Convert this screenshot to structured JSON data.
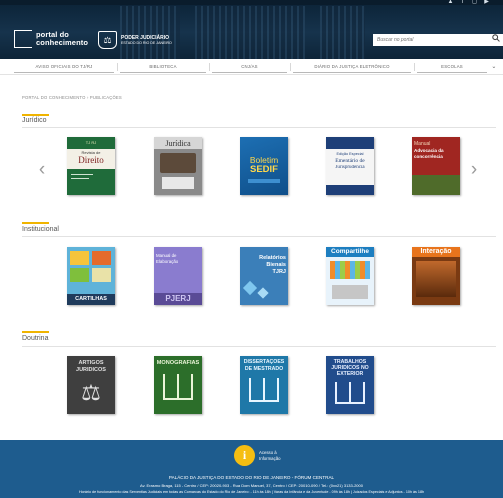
{
  "header": {
    "portal_line1": "portal do",
    "portal_line2": "conhecimento",
    "pj_title": "PODER JUDICIÁRIO",
    "pj_subtitle": "ESTADO DO RIO DE JANEIRO",
    "search_placeholder": "Buscar no portal",
    "social_icons": [
      "twitter-icon",
      "facebook-icon",
      "instagram-icon",
      "youtube-icon"
    ]
  },
  "nav": {
    "items": [
      {
        "label": "AVISO OFICIAIS DO TJ/RJ"
      },
      {
        "label": "BIBLIOTECA"
      },
      {
        "label": "CNJ/AS"
      },
      {
        "label": "DIÁRIO DA JUSTIÇA ELETRÔNICO"
      },
      {
        "label": "ESCOLAS"
      }
    ],
    "more_icon": "chevron-down-icon"
  },
  "breadcrumb": "PORTAL DO CONHECIMENTO  ›  PUBLICAÇÕES",
  "sections": [
    {
      "title": "Jurídico",
      "books": [
        {
          "l1": "TJ RJ",
          "l2": "Revista de",
          "l3": "Direito",
          "color": "#1f6b3a"
        },
        {
          "l1": "",
          "l2": "Jurídica",
          "l3": "",
          "color": "#8a8a8a"
        },
        {
          "l1": "",
          "l2": "Boletim",
          "l3": "SEDIF",
          "color": "#1d6fb3"
        },
        {
          "l1": "Edição Especial",
          "l2": "Ementário de",
          "l3": "Jurisprudência",
          "color": "#1e3f78"
        },
        {
          "l1": "Manual",
          "l2": "Advocacia da",
          "l3": "concorrência",
          "color": "#a02621"
        }
      ]
    },
    {
      "title": "Institucional",
      "books": [
        {
          "l1": "",
          "l2": "",
          "l3": "CARTILHAS",
          "color": "#2e6fa8"
        },
        {
          "l1": "Manual de",
          "l2": "Elaboração",
          "l3": "PJERJ",
          "color": "#6a5aa5"
        },
        {
          "l1": "Relatórios",
          "l2": "Bienais",
          "l3": "TJRJ",
          "color": "#3b7fb9"
        },
        {
          "l1": "Compartilhe",
          "l2": "",
          "l3": "",
          "color": "#1d7ec0"
        },
        {
          "l1": "Interação",
          "l2": "",
          "l3": "",
          "color": "#7a3a12"
        }
      ]
    },
    {
      "title": "Doutrina",
      "books": [
        {
          "l1": "ARTIGOS",
          "l2": "JURÍDICOS",
          "l3": "",
          "color": "#3f3f3f"
        },
        {
          "l1": "MONOGRAFIAS",
          "l2": "",
          "l3": "",
          "color": "#2c6e2a"
        },
        {
          "l1": "DISSERTAÇÕES",
          "l2": "DE MESTRADO",
          "l3": "",
          "color": "#1f78a8"
        },
        {
          "l1": "TRABALHOS",
          "l2": "JURÍDICOS NO",
          "l3": "EXTERIOR",
          "color": "#214c8c"
        }
      ]
    }
  ],
  "carousel": {
    "prev_icon": "chevron-left-icon",
    "next_icon": "chevron-right-icon"
  },
  "footer": {
    "acesso_line1": "Acesso à",
    "acesso_line2": "Informação",
    "line1": "PALÁCIO DA JUSTIÇA DO ESTADO DO RIO DE JANEIRO - FÓRUM CENTRAL",
    "line2": "Av. Erasmo Braga, 115 - Centro / CEP: 20020-903 - Rua Dom Manuel, 37, Centro / CEP: 20010-090 / Tel.: (0xx21) 3133-2000",
    "line3": "Horário de funcionamento das Serventias Judiciais em todas as Comarcas do Estado do Rio de Janeiro: - 11h às 18h | Varas da Infância e da Juventude - 09h às 18h | Juizados Especiais e Adjuntos - 10h às 18h",
    "accent": "#1e5c8e"
  }
}
